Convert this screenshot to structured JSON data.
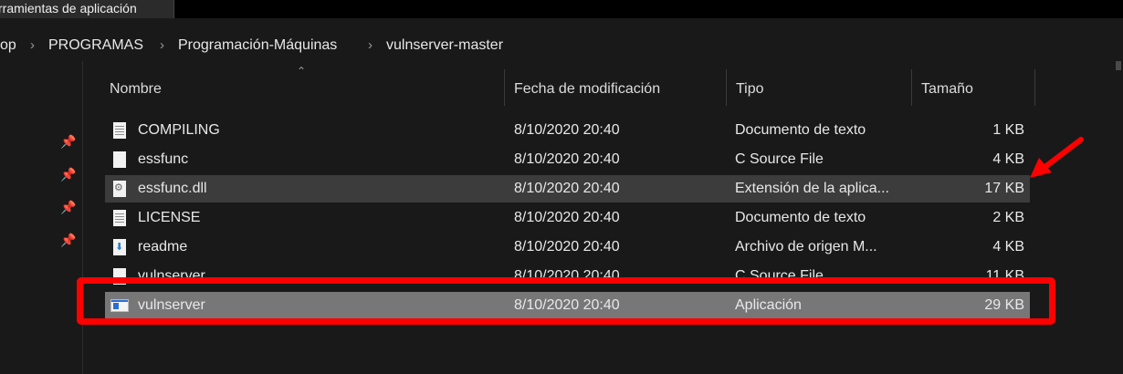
{
  "ribbon": {
    "tab_label": "rramientas de aplicación"
  },
  "breadcrumb": {
    "items": [
      "op",
      "PROGRAMAS",
      "Programación-Máquinas",
      "vulnserver-master"
    ],
    "separator": "›"
  },
  "columns": {
    "name": "Nombre",
    "date": "Fecha de modificación",
    "type": "Tipo",
    "size": "Tamaño"
  },
  "files": [
    {
      "name": "COMPILING",
      "date": "8/10/2020 20:40",
      "type": "Documento de texto",
      "size": "1 KB",
      "icon": "text-file-icon"
    },
    {
      "name": "essfunc",
      "date": "8/10/2020 20:40",
      "type": "C Source File",
      "size": "4 KB",
      "icon": "source-file-icon"
    },
    {
      "name": "essfunc.dll",
      "date": "8/10/2020 20:40",
      "type": "Extensión de la aplica...",
      "size": "17 KB",
      "icon": "dll-file-icon"
    },
    {
      "name": "LICENSE",
      "date": "8/10/2020 20:40",
      "type": "Documento de texto",
      "size": "2 KB",
      "icon": "text-file-icon"
    },
    {
      "name": "readme",
      "date": "8/10/2020 20:40",
      "type": "Archivo de origen M...",
      "size": "4 KB",
      "icon": "markdown-file-icon"
    },
    {
      "name": "vulnserver",
      "date": "8/10/2020 20:40",
      "type": "C Source File",
      "size": "11 KB",
      "icon": "source-file-icon"
    },
    {
      "name": "vulnserver",
      "date": "8/10/2020 20:40",
      "type": "Aplicación",
      "size": "29 KB",
      "icon": "application-icon"
    }
  ],
  "colors": {
    "background": "#191919",
    "selected_row": "#777777",
    "highlight_row": "#3c3c3c",
    "annotation_red": "#ff0000"
  }
}
